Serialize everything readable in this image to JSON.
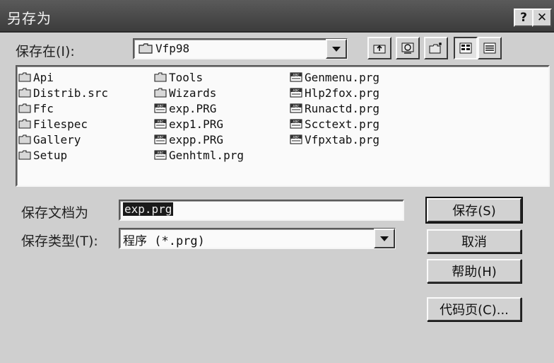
{
  "window": {
    "title": "另存为",
    "help_label": "?",
    "close_label": "✕"
  },
  "save_in": {
    "label": "保存在(I):",
    "value": "Vfp98"
  },
  "toolbar": [
    {
      "name": "up-one-level-icon"
    },
    {
      "name": "desktop-icon"
    },
    {
      "name": "new-folder-icon"
    },
    {
      "name": "list-view-icon"
    },
    {
      "name": "details-view-icon"
    }
  ],
  "files": {
    "col1": [
      {
        "label": "Api",
        "icon": "folder-icon"
      },
      {
        "label": "Distrib.src",
        "icon": "folder-icon"
      },
      {
        "label": "Ffc",
        "icon": "folder-icon"
      },
      {
        "label": "Filespec",
        "icon": "folder-icon"
      },
      {
        "label": "Gallery",
        "icon": "folder-icon"
      },
      {
        "label": "Setup",
        "icon": "folder-icon"
      }
    ],
    "col2": [
      {
        "label": "Tools",
        "icon": "folder-icon"
      },
      {
        "label": "Wizards",
        "icon": "folder-icon"
      },
      {
        "label": "exp.PRG",
        "icon": "program-file-icon"
      },
      {
        "label": "exp1.PRG",
        "icon": "program-file-icon"
      },
      {
        "label": "expp.PRG",
        "icon": "program-file-icon"
      },
      {
        "label": "Genhtml.prg",
        "icon": "program-file-icon"
      }
    ],
    "col3": [
      {
        "label": "Genmenu.prg",
        "icon": "program-file-icon"
      },
      {
        "label": "Hlp2fox.prg",
        "icon": "program-file-icon"
      },
      {
        "label": "Runactd.prg",
        "icon": "program-file-icon"
      },
      {
        "label": "Scctext.prg",
        "icon": "program-file-icon"
      },
      {
        "label": "Vfpxtab.prg",
        "icon": "program-file-icon"
      }
    ]
  },
  "filename": {
    "label": "保存文档为",
    "value": "exp.prg"
  },
  "filetype": {
    "label": "保存类型(T):",
    "value": "程序 (*.prg)"
  },
  "buttons": {
    "save": "保存(S)",
    "cancel": "取消",
    "help": "帮助(H)",
    "codepage": "代码页(C)..."
  }
}
